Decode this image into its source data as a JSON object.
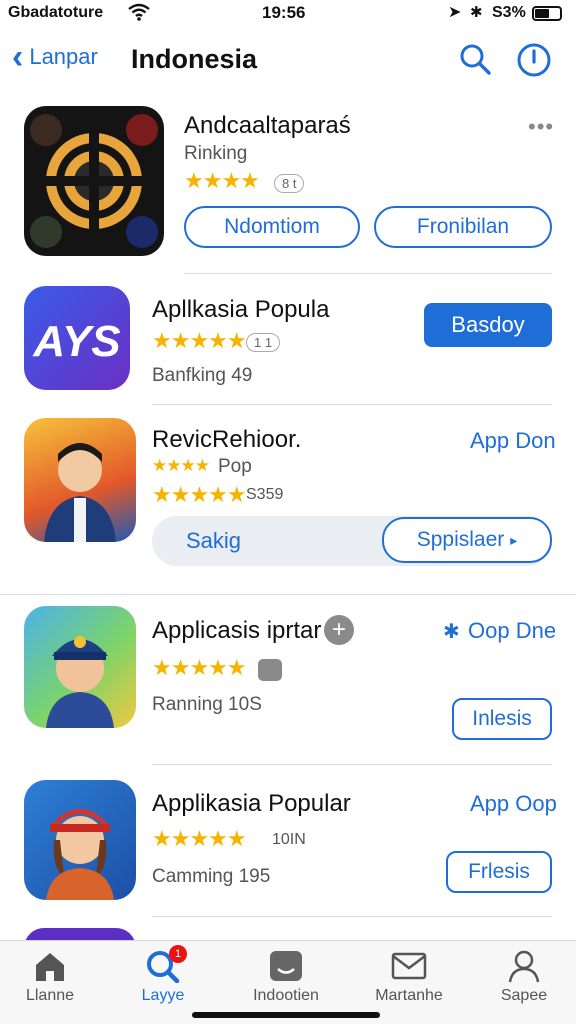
{
  "status": {
    "carrier": "Gbadatoture",
    "time": "19:56",
    "battery": "S3%"
  },
  "nav": {
    "back_label": "Lanpar",
    "title": "Indonesia"
  },
  "apps": [
    {
      "name": "Andcaaltaparaś",
      "sub": "Rinking",
      "stars": "★★★★",
      "count": "8 t",
      "buttons": [
        "Ndomtiom",
        "Fronibilan"
      ]
    },
    {
      "name": "Apllkasia Popula",
      "stars": "★★★★★",
      "count": "1 1",
      "sub": "Banfking  49",
      "button": "Basdoy"
    },
    {
      "name": "RevicRehioor.",
      "stars_small": "★★★★",
      "sub_small": "Pop",
      "stars": "★★★★★",
      "count": "S359",
      "link": "App Don",
      "segment_left": "Sakig",
      "segment_right": "Sppislaer"
    },
    {
      "name": "Applicasis iprtar",
      "stars": "★★★★★",
      "sub": "Ranning  10S",
      "link": "Oop Dne",
      "button": "Inlesis"
    },
    {
      "name": "Applikasia Popular",
      "stars": "★★★★★",
      "count": "10IN",
      "sub": "Camming  195",
      "link": "App Oop",
      "button": "Frlesis"
    }
  ],
  "tabs": [
    {
      "label": "Llanne",
      "icon": "home-icon"
    },
    {
      "label": "Layye",
      "icon": "search-icon",
      "badge": "1"
    },
    {
      "label": "Indootien",
      "icon": "media-icon"
    },
    {
      "label": "Martanhe",
      "icon": "mail-icon"
    },
    {
      "label": "Sapee",
      "icon": "person-icon"
    }
  ],
  "colors": {
    "accent": "#1f6ed8",
    "star": "#f4b400",
    "badge": "#e11111"
  }
}
